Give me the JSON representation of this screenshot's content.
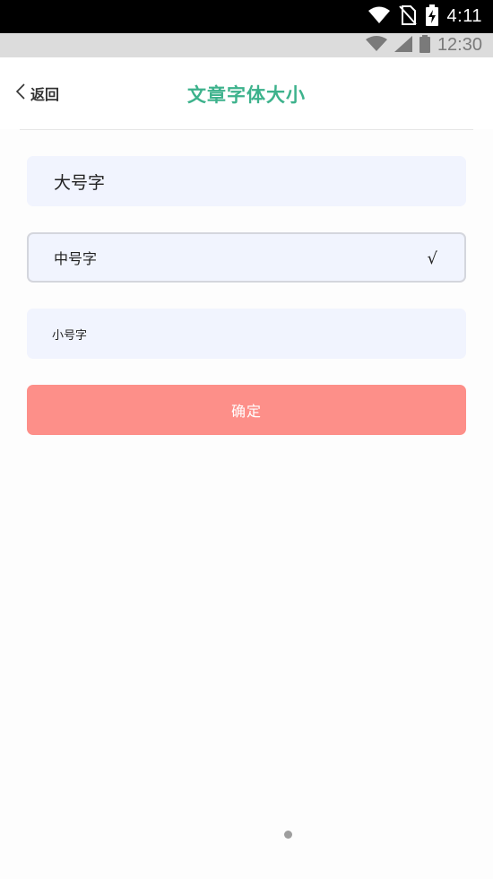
{
  "statusbar_top": {
    "time": "4:11"
  },
  "statusbar_inner": {
    "time": "12:30"
  },
  "header": {
    "back_label": "返回",
    "title": "文章字体大小",
    "title_color": "#3db28c"
  },
  "options": [
    {
      "label": "大号字",
      "selected": false
    },
    {
      "label": "中号字",
      "selected": true,
      "check_mark": "√"
    },
    {
      "label": "小号字",
      "selected": false
    }
  ],
  "confirm": {
    "label": "确定",
    "color": "#fd8f89"
  },
  "icons": [
    "wifi-icon",
    "no-sim-icon",
    "battery-charging-icon",
    "signal-icon",
    "battery-icon",
    "chevron-left-icon",
    "check-icon"
  ]
}
